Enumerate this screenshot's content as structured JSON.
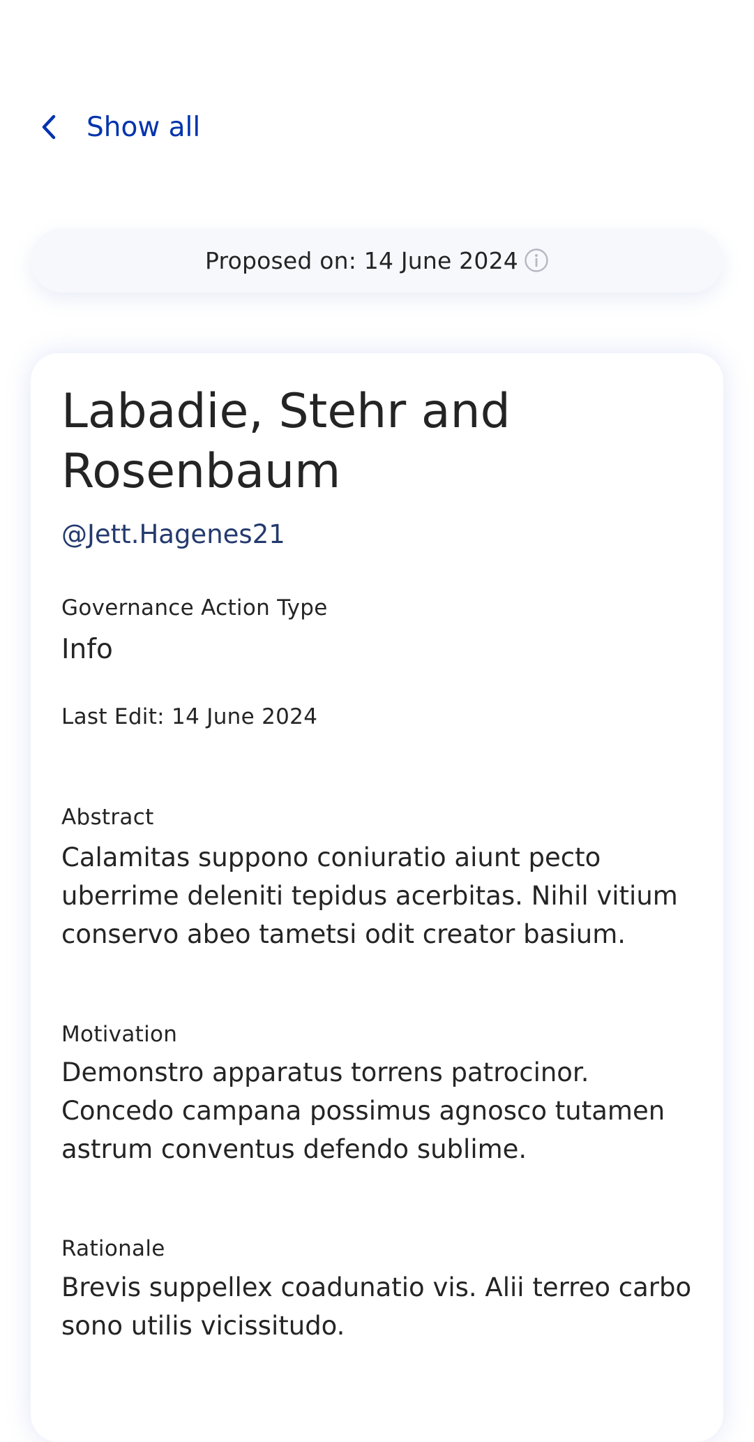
{
  "nav": {
    "back_label": "Show all",
    "back_icon": "chevron-left-icon"
  },
  "proposed": {
    "text": "Proposed on: 14 June 2024",
    "info_icon": "info-icon"
  },
  "proposal": {
    "title": "Labadie, Stehr and Rosenbaum",
    "username": "@Jett.Hagenes21",
    "governance_action_type_label": "Governance Action Type",
    "governance_action_type_value": "Info",
    "last_edit": "Last Edit: 14 June 2024",
    "abstract_label": "Abstract",
    "abstract_text": "Calamitas suppono coniuratio aiunt pecto uberrime deleniti tepidus acerbitas. Nihil vitium conservo abeo tametsi odit creator basium.",
    "motivation_label": "Motivation",
    "motivation_text": "Demonstro apparatus torrens patrocinor. Concedo campana possimus agnosco tutamen astrum conventus defendo sublime.",
    "rationale_label": "Rationale",
    "rationale_text": "Brevis suppellex coadunatio vis. Alii terreo carbo sono utilis vicissitudo."
  },
  "colors": {
    "link": "#0033ad",
    "username": "#243a6e",
    "text": "#242424",
    "pill_background": "#f6f8fc"
  }
}
